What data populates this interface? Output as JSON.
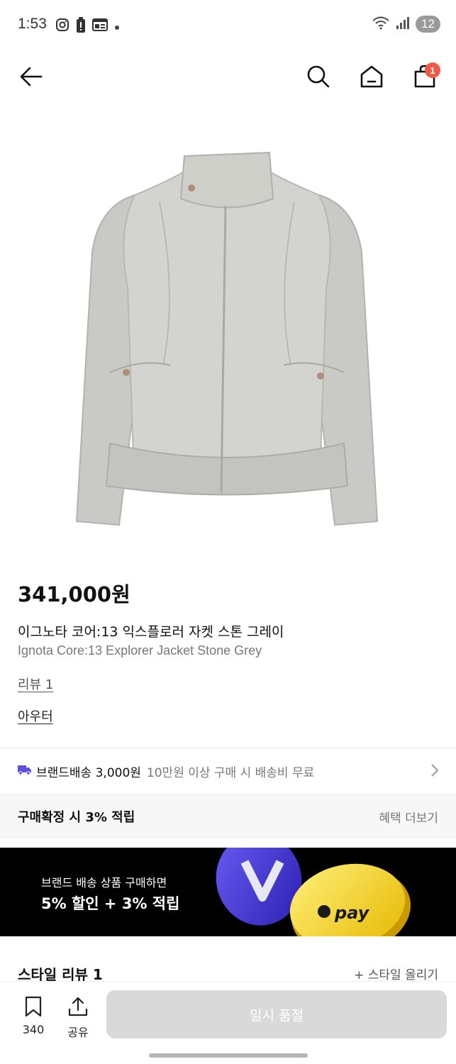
{
  "status_bar": {
    "time": "1:53",
    "left_icons": [
      "instagram-icon",
      "battery-alert-icon",
      "news-icon",
      "dot-icon"
    ],
    "right_icons": [
      "wifi-icon",
      "signal-icon"
    ],
    "battery": "12"
  },
  "nav": {
    "icons": [
      "back-arrow-icon",
      "search-icon",
      "home-icon",
      "shopping-bag-icon"
    ],
    "cart_count": "1"
  },
  "product": {
    "price": "341,000원",
    "name_ko": "이그노타 코어:13 익스플로러 자켓 스톤 그레이",
    "name_en": "Ignota Core:13 Explorer Jacket Stone Grey",
    "review_link": "리뷰 1",
    "category": "아우터"
  },
  "shipping": {
    "icon": "truck-icon",
    "main": "브랜드배송 3,000원",
    "sub": "10만원 이상 구매 시 배송비 무료"
  },
  "reward": {
    "title": "구매확정 시 3% 적립",
    "more": "혜택 더보기"
  },
  "banner": {
    "line1": "브랜드 배송 상품 구매하면",
    "line2": "5% 할인 + 3% 적립",
    "coin_text": "pay"
  },
  "style_review": {
    "title": "스타일 리뷰 1",
    "add": "+ 스타일 올리기"
  },
  "bottom_bar": {
    "bookmark_count": "340",
    "share_label": "공유",
    "soldout_label": "일시 품절"
  },
  "colors": {
    "accent": "#5b4fe0",
    "badge": "#ef5a45",
    "disabled_button": "#d9d9d9",
    "coin_yellow": "#f4d51d"
  }
}
